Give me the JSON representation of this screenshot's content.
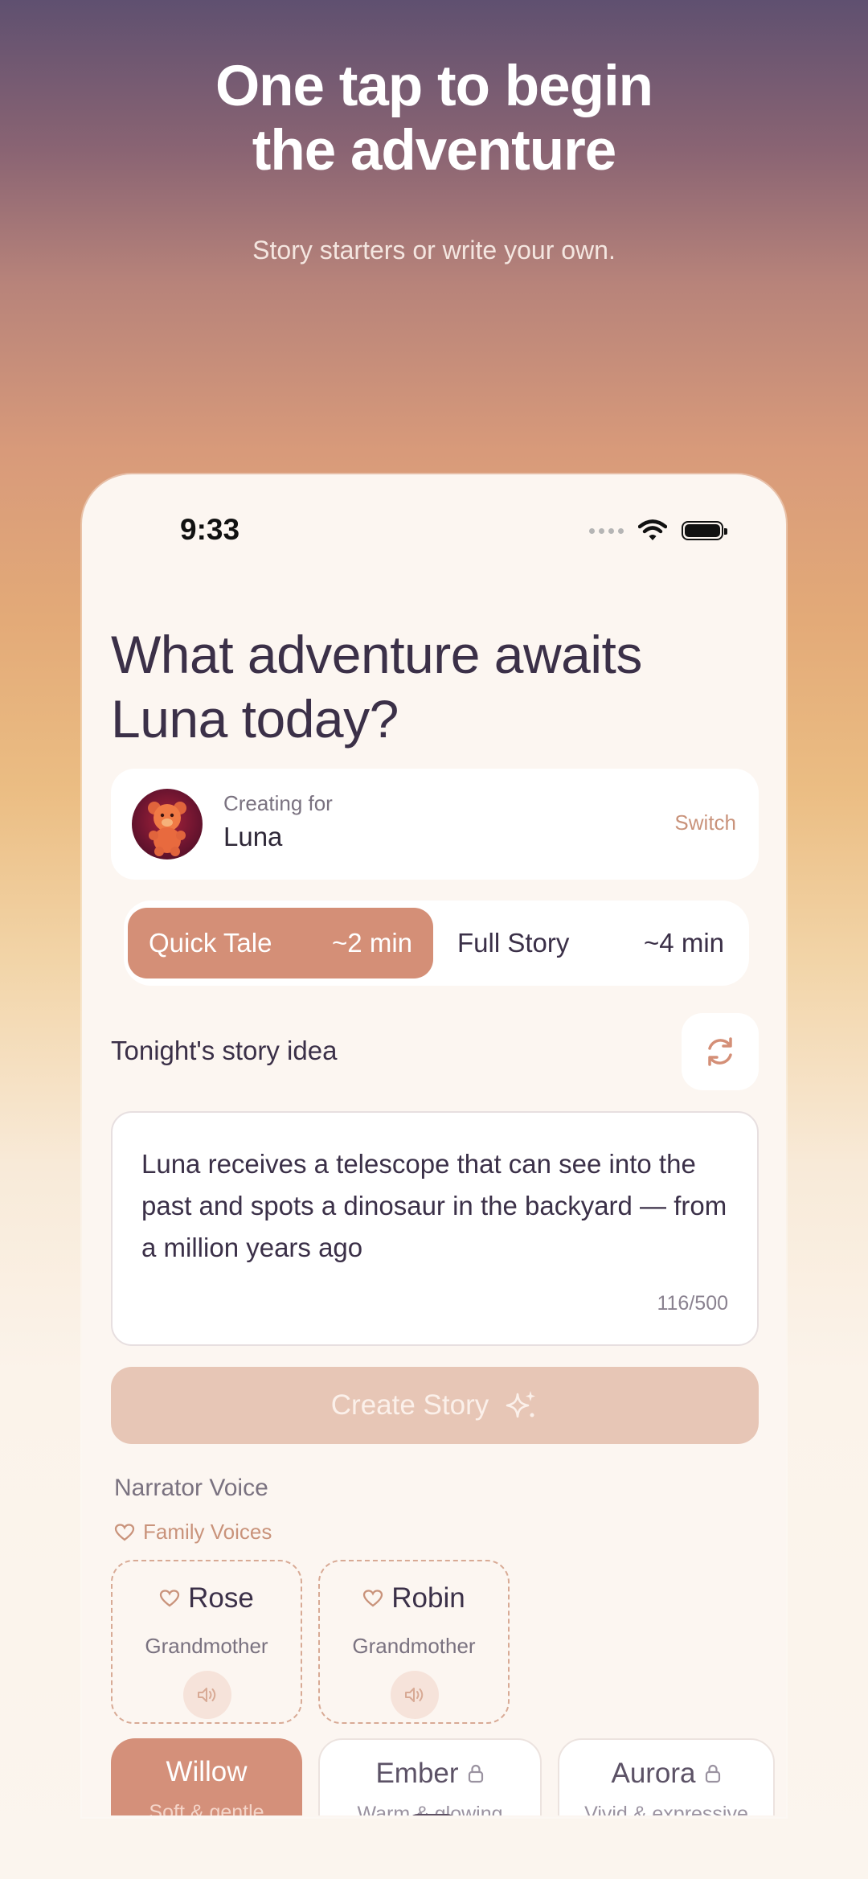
{
  "marketing": {
    "headline_line1": "One tap to begin",
    "headline_line2": "the adventure",
    "subline": "Story starters or write your own."
  },
  "status_bar": {
    "time": "9:33"
  },
  "screen": {
    "title_line1": "What adventure awaits",
    "title_line2": "Luna today?",
    "profile": {
      "label": "Creating for",
      "name": "Luna",
      "switch_label": "Switch"
    },
    "length_toggle": {
      "quick_label": "Quick Tale",
      "quick_duration": "~2 min",
      "full_label": "Full Story",
      "full_duration": "~4 min",
      "selected": "quick"
    },
    "idea": {
      "label": "Tonight's story idea",
      "text": "Luna receives a telescope that can see into the past and spots a dinosaur in the backyard — from a million years ago",
      "char_count": "116/500"
    },
    "create_button": "Create Story",
    "narrator": {
      "label": "Narrator Voice",
      "family_label": "Family Voices",
      "family_voices": [
        {
          "name": "Rose",
          "role": "Grandmother"
        },
        {
          "name": "Robin",
          "role": "Grandmother"
        }
      ],
      "voices": [
        {
          "name": "Willow",
          "desc": "Soft & gentle",
          "selected": true
        },
        {
          "name": "Ember",
          "desc": "Warm & glowing",
          "locked": true
        },
        {
          "name": "Aurora",
          "desc": "Vivid & expressive",
          "locked": true
        }
      ]
    }
  },
  "colors": {
    "accent": "#d48f77",
    "accent_text": "#c9937b",
    "text_primary": "#3b3048",
    "create_button_disabled": "#e7c6b6"
  }
}
